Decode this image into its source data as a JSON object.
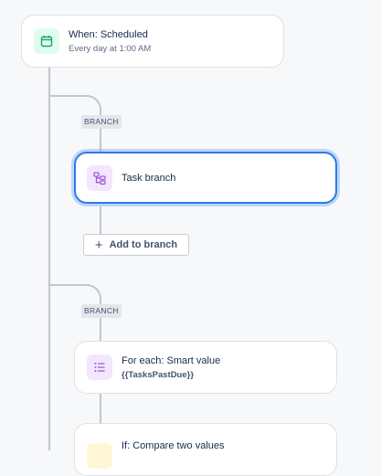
{
  "nodes": {
    "trigger": {
      "title": "When: Scheduled",
      "subtitle": "Every day at 1:00 AM",
      "icon": "calendar-icon"
    },
    "task_branch": {
      "title": "Task branch",
      "icon": "branch-icon"
    },
    "for_each": {
      "title": "For each: Smart value",
      "subtitle": "{{TasksPastDue}}",
      "icon": "list-icon"
    },
    "condition": {
      "title": "If: Compare two values",
      "icon": "condition-icon"
    }
  },
  "branch_tags": [
    "BRANCH",
    "BRANCH"
  ],
  "add_to_branch": {
    "label": "Add to branch",
    "icon": "plus-icon"
  },
  "colors": {
    "accent": "#2d7be5",
    "trigger_icon": "#22a06b",
    "branch_icon": "#a35bd6",
    "background": "#f7f8f9"
  }
}
